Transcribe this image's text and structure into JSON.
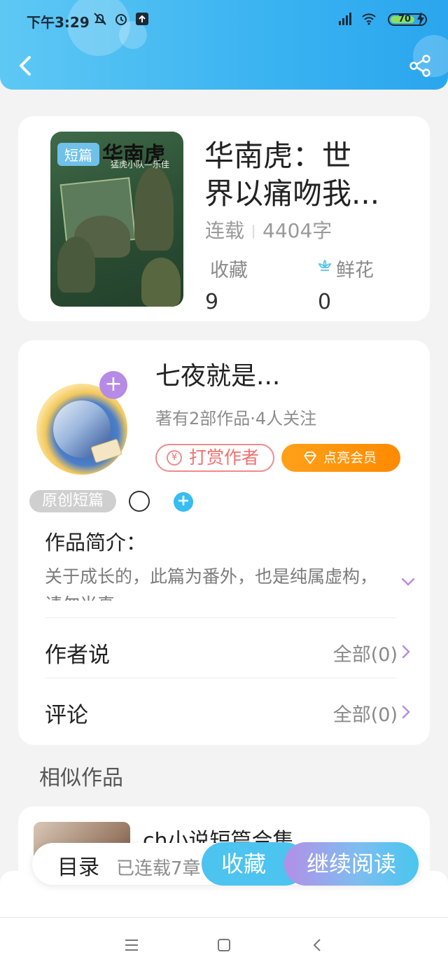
{
  "status_bar": {
    "time": "下午3:29",
    "battery": "70"
  },
  "book": {
    "cover_tag": "短篇",
    "cover_title": "华南虎",
    "cover_subtitle": "猛虎小队—乐佳",
    "title_line1": "华南虎：世",
    "title_line2": "界以痛吻我...",
    "status": "连载",
    "word_count": "4404字",
    "favorites_label": "收藏",
    "favorites_value": "9",
    "flowers_label": "鲜花",
    "flowers_value": "0"
  },
  "author": {
    "name": "七夜就是...",
    "stats": "著有2部作品·4人关注",
    "tip_label": "打赏作者",
    "vip_label": "点亮会员",
    "follow_symbol": "+"
  },
  "tags": {
    "original": "原创短篇",
    "add_symbol": "+"
  },
  "intro": {
    "label": "作品简介：",
    "text": "关于成长的，此篇为番外，也是纯属虚构，请勿当真"
  },
  "rows": [
    {
      "label": "作者说",
      "value": "全部(0)"
    },
    {
      "label": "评论",
      "value": "全部(0)"
    }
  ],
  "similar": {
    "section_title": "相似作品",
    "item_title": "ch小说短篇合集"
  },
  "bottom_bar": {
    "toc_label": "目录",
    "serial_label": "已连载7章",
    "favorite_button": "收藏",
    "read_button": "继续阅读"
  },
  "colors": {
    "header": "#3ab3f1",
    "accent_purple": "#b58be6",
    "tip_red": "#f07070",
    "vip_orange": "#ff8a00"
  }
}
